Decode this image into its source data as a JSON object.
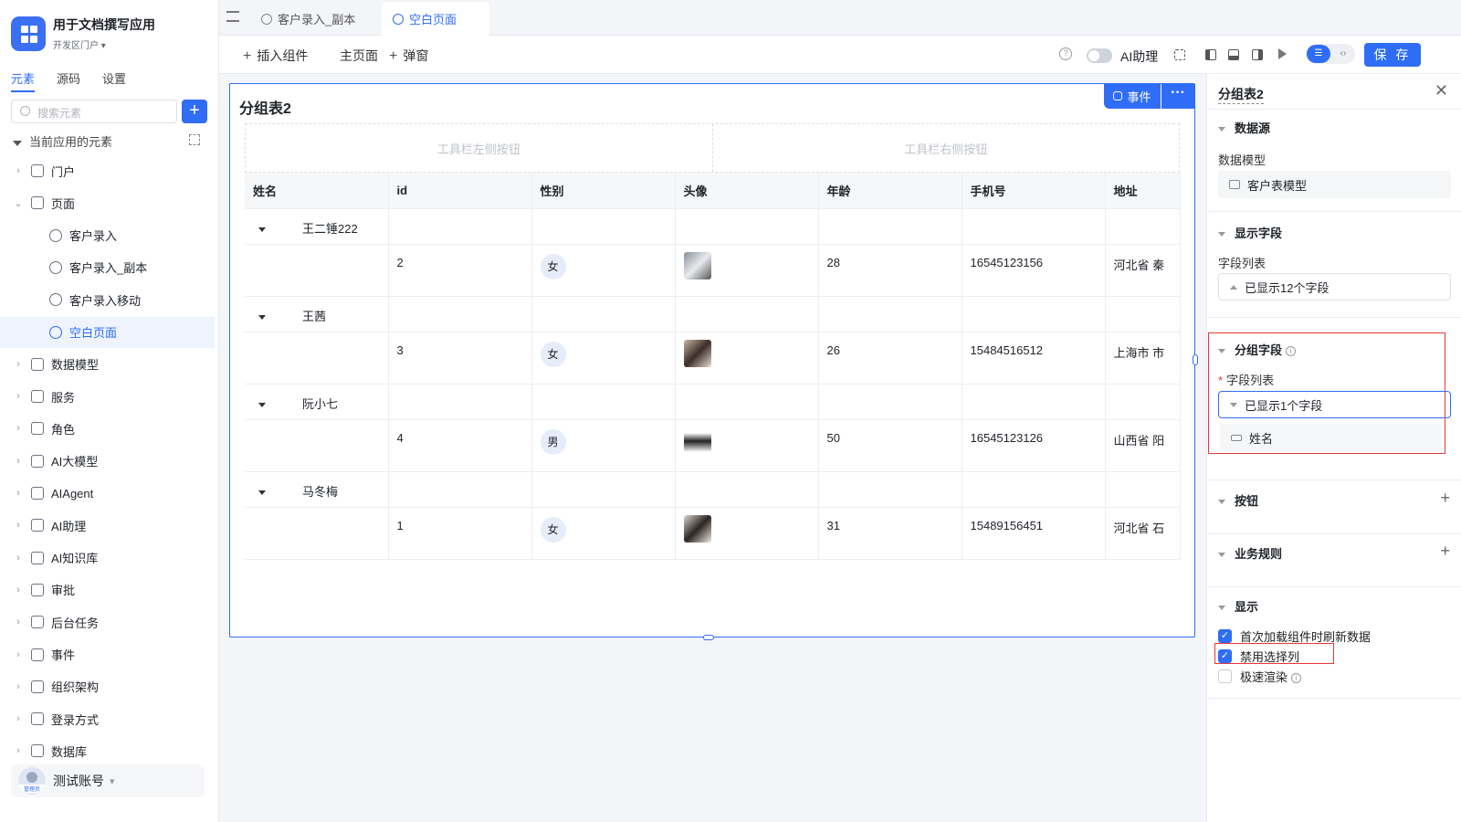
{
  "app": {
    "title": "用于文档撰写应用",
    "subtitle": "开发区门户"
  },
  "left_tabs": [
    "元素",
    "源码",
    "设置"
  ],
  "search": {
    "placeholder": "搜索元素"
  },
  "tree": {
    "header": "当前应用的元素",
    "nodes": [
      {
        "label": "门户",
        "icon": "home-icon",
        "type": "parent"
      },
      {
        "label": "页面",
        "icon": "page-icon",
        "type": "parent-open"
      },
      {
        "label": "客户录入",
        "icon": "page-item-icon",
        "type": "child"
      },
      {
        "label": "客户录入_副本",
        "icon": "page-item-icon",
        "type": "child"
      },
      {
        "label": "客户录入移动",
        "icon": "page-item-icon",
        "type": "child"
      },
      {
        "label": "空白页面",
        "icon": "page-item-icon",
        "type": "child-selected"
      },
      {
        "label": "数据模型",
        "icon": "table-icon",
        "type": "parent"
      },
      {
        "label": "服务",
        "icon": "service-icon",
        "type": "parent"
      },
      {
        "label": "角色",
        "icon": "role-icon",
        "type": "parent"
      },
      {
        "label": "AI大模型",
        "icon": "ai-model-icon",
        "type": "parent"
      },
      {
        "label": "AIAgent",
        "icon": "robot-icon",
        "type": "parent"
      },
      {
        "label": "AI助理",
        "icon": "ai-assistant-icon",
        "type": "parent"
      },
      {
        "label": "AI知识库",
        "icon": "knowledge-icon",
        "type": "parent"
      },
      {
        "label": "审批",
        "icon": "approval-icon",
        "type": "parent"
      },
      {
        "label": "后台任务",
        "icon": "task-icon",
        "type": "parent"
      },
      {
        "label": "事件",
        "icon": "event-icon",
        "type": "parent"
      },
      {
        "label": "组织架构",
        "icon": "org-icon",
        "type": "parent"
      },
      {
        "label": "登录方式",
        "icon": "login-icon",
        "type": "parent"
      },
      {
        "label": "数据库",
        "icon": "database-icon",
        "type": "parent"
      }
    ]
  },
  "user": {
    "name": "测试账号",
    "role": "管理员"
  },
  "page_tabs": [
    {
      "label": "客户录入_副本",
      "active": false
    },
    {
      "label": "空白页面",
      "active": true
    }
  ],
  "toolbar": {
    "insert": "插入组件",
    "main_page": "主页面",
    "popup": "弹窗",
    "ai_assistant": "AI助理",
    "save": "保 存"
  },
  "canvas": {
    "title": "分组表2",
    "event_btn": "事件",
    "toolbar_left": "工具栏左侧按钮",
    "toolbar_right": "工具栏右侧按钮",
    "columns": [
      "姓名",
      "id",
      "性别",
      "头像",
      "年龄",
      "手机号",
      "地址"
    ],
    "groups": [
      {
        "name": "王二锤222",
        "row": {
          "id": "2",
          "gender": "女",
          "age": "28",
          "phone": "16545123156",
          "addr": "河北省 秦"
        }
      },
      {
        "name": "王茜",
        "row": {
          "id": "3",
          "gender": "女",
          "age": "26",
          "phone": "15484516512",
          "addr": "上海市 市"
        }
      },
      {
        "name": "阮小七",
        "row": {
          "id": "4",
          "gender": "男",
          "age": "50",
          "phone": "16545123126",
          "addr": "山西省 阳"
        }
      },
      {
        "name": "马冬梅",
        "row": {
          "id": "1",
          "gender": "女",
          "age": "31",
          "phone": "15489156451",
          "addr": "河北省 石"
        }
      }
    ]
  },
  "panel": {
    "title": "分组表2",
    "datasource": {
      "section": "数据源",
      "label": "数据模型",
      "value": "客户表模型"
    },
    "display_fields": {
      "section": "显示字段",
      "label": "字段列表",
      "value": "已显示12个字段"
    },
    "group_fields": {
      "section": "分组字段",
      "label": "字段列表",
      "value": "已显示1个字段",
      "item": "姓名"
    },
    "buttons": {
      "section": "按钮"
    },
    "rules": {
      "section": "业务规则"
    },
    "display": {
      "section": "显示",
      "options": [
        {
          "label": "首次加载组件时刷新数据",
          "checked": true
        },
        {
          "label": "禁用选择列",
          "checked": true
        },
        {
          "label": "极速渲染",
          "checked": false
        }
      ]
    }
  },
  "colors": {
    "accent": "#2f6df6",
    "highlight": "#e53935"
  }
}
